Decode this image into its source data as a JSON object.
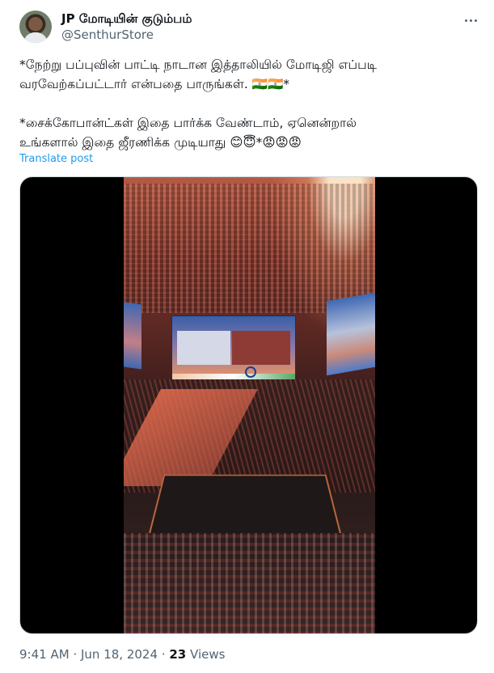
{
  "author": {
    "display_name": "JP மோடியின் குடும்பம்",
    "handle": "@SenthurStore"
  },
  "post": {
    "line1": "*நேற்று பப்புவின் பாட்டி நாடான இத்தாலியில் மோடிஜி எப்படி",
    "line2": "வரவேற்கப்பட்டார் என்பதை பாருங்கள். 🇮🇳🇮🇳*",
    "line3": "*சைக்கோபான்ட்கள் இதை பார்க்க வேண்டாம், ஏனென்றால்",
    "line4": "உங்களால் இதை ஜீரணிக்க முடியாது 😊😇*😡😡😡",
    "translate_label": "Translate post"
  },
  "footer": {
    "time": "9:41 AM",
    "separator": "·",
    "date": "Jun 18, 2024",
    "views_count": "23",
    "views_label": "Views"
  },
  "icons": {
    "more": "more-options-icon"
  },
  "colors": {
    "text_primary": "#0f1419",
    "text_secondary": "#536471",
    "link": "#1d9bf0"
  }
}
